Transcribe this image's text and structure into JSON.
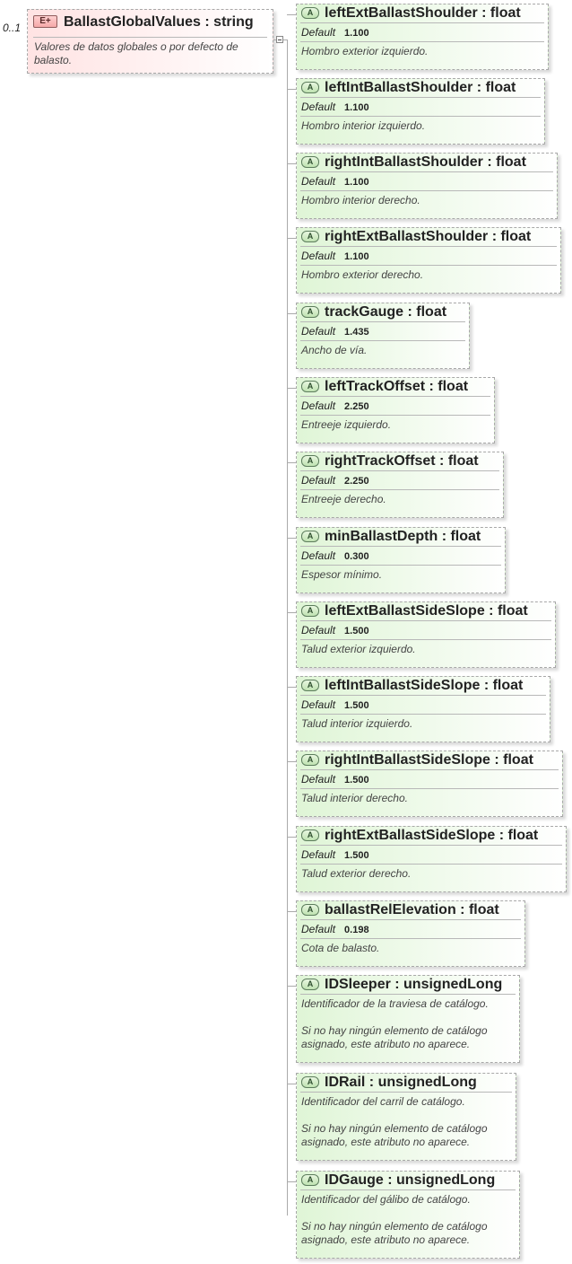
{
  "element": {
    "occurrence": "0..1",
    "badge": "E+",
    "name": "BallastGlobalValues",
    "type": "string",
    "doc": "Valores de datos globales o por defecto de balasto."
  },
  "default_label": "Default",
  "attr_badge": "A",
  "attributes": [
    {
      "name": "leftExtBallastShoulder",
      "type": "float",
      "default": "1.100",
      "doc": [
        "Hombro exterior izquierdo."
      ]
    },
    {
      "name": "leftIntBallastShoulder",
      "type": "float",
      "default": "1.100",
      "doc": [
        "Hombro interior izquierdo."
      ]
    },
    {
      "name": "rightIntBallastShoulder",
      "type": "float",
      "default": "1.100",
      "doc": [
        "Hombro interior derecho."
      ]
    },
    {
      "name": "rightExtBallastShoulder",
      "type": "float",
      "default": "1.100",
      "doc": [
        "Hombro exterior derecho."
      ]
    },
    {
      "name": "trackGauge",
      "type": "float",
      "default": "1.435",
      "doc": [
        "Ancho de vía."
      ]
    },
    {
      "name": "leftTrackOffset",
      "type": "float",
      "default": "2.250",
      "doc": [
        "Entreeje izquierdo."
      ]
    },
    {
      "name": "rightTrackOffset",
      "type": "float",
      "default": "2.250",
      "doc": [
        "Entreeje derecho."
      ]
    },
    {
      "name": "minBallastDepth",
      "type": "float",
      "default": "0.300",
      "doc": [
        "Espesor mínimo."
      ]
    },
    {
      "name": "leftExtBallastSideSlope",
      "type": "float",
      "default": "1.500",
      "doc": [
        "Talud exterior izquierdo."
      ]
    },
    {
      "name": "leftIntBallastSideSlope",
      "type": "float",
      "default": "1.500",
      "doc": [
        "Talud interior izquierdo."
      ]
    },
    {
      "name": "rightIntBallastSideSlope",
      "type": "float",
      "default": "1.500",
      "doc": [
        "Talud interior derecho."
      ]
    },
    {
      "name": "rightExtBallastSideSlope",
      "type": "float",
      "default": "1.500",
      "doc": [
        "Talud exterior derecho."
      ]
    },
    {
      "name": "ballastRelElevation",
      "type": "float",
      "default": "0.198",
      "doc": [
        "Cota de balasto."
      ]
    },
    {
      "name": "IDSleeper",
      "type": "unsignedLong",
      "default": "",
      "doc": [
        "Identificador de la traviesa de catálogo.",
        "",
        "Si no hay ningún elemento de catálogo",
        "asignado, este atributo no aparece."
      ]
    },
    {
      "name": "IDRail",
      "type": "unsignedLong",
      "default": "",
      "doc": [
        "Identificador del carril de catálogo.",
        "",
        "Si no hay ningún elemento de catálogo",
        "asignado, este atributo no aparece."
      ]
    },
    {
      "name": "IDGauge",
      "type": "unsignedLong",
      "default": "",
      "doc": [
        "Identificador del gálibo de catálogo.",
        "",
        "Si no hay ningún elemento de catálogo",
        "asignado, este atributo no aparece."
      ]
    }
  ]
}
